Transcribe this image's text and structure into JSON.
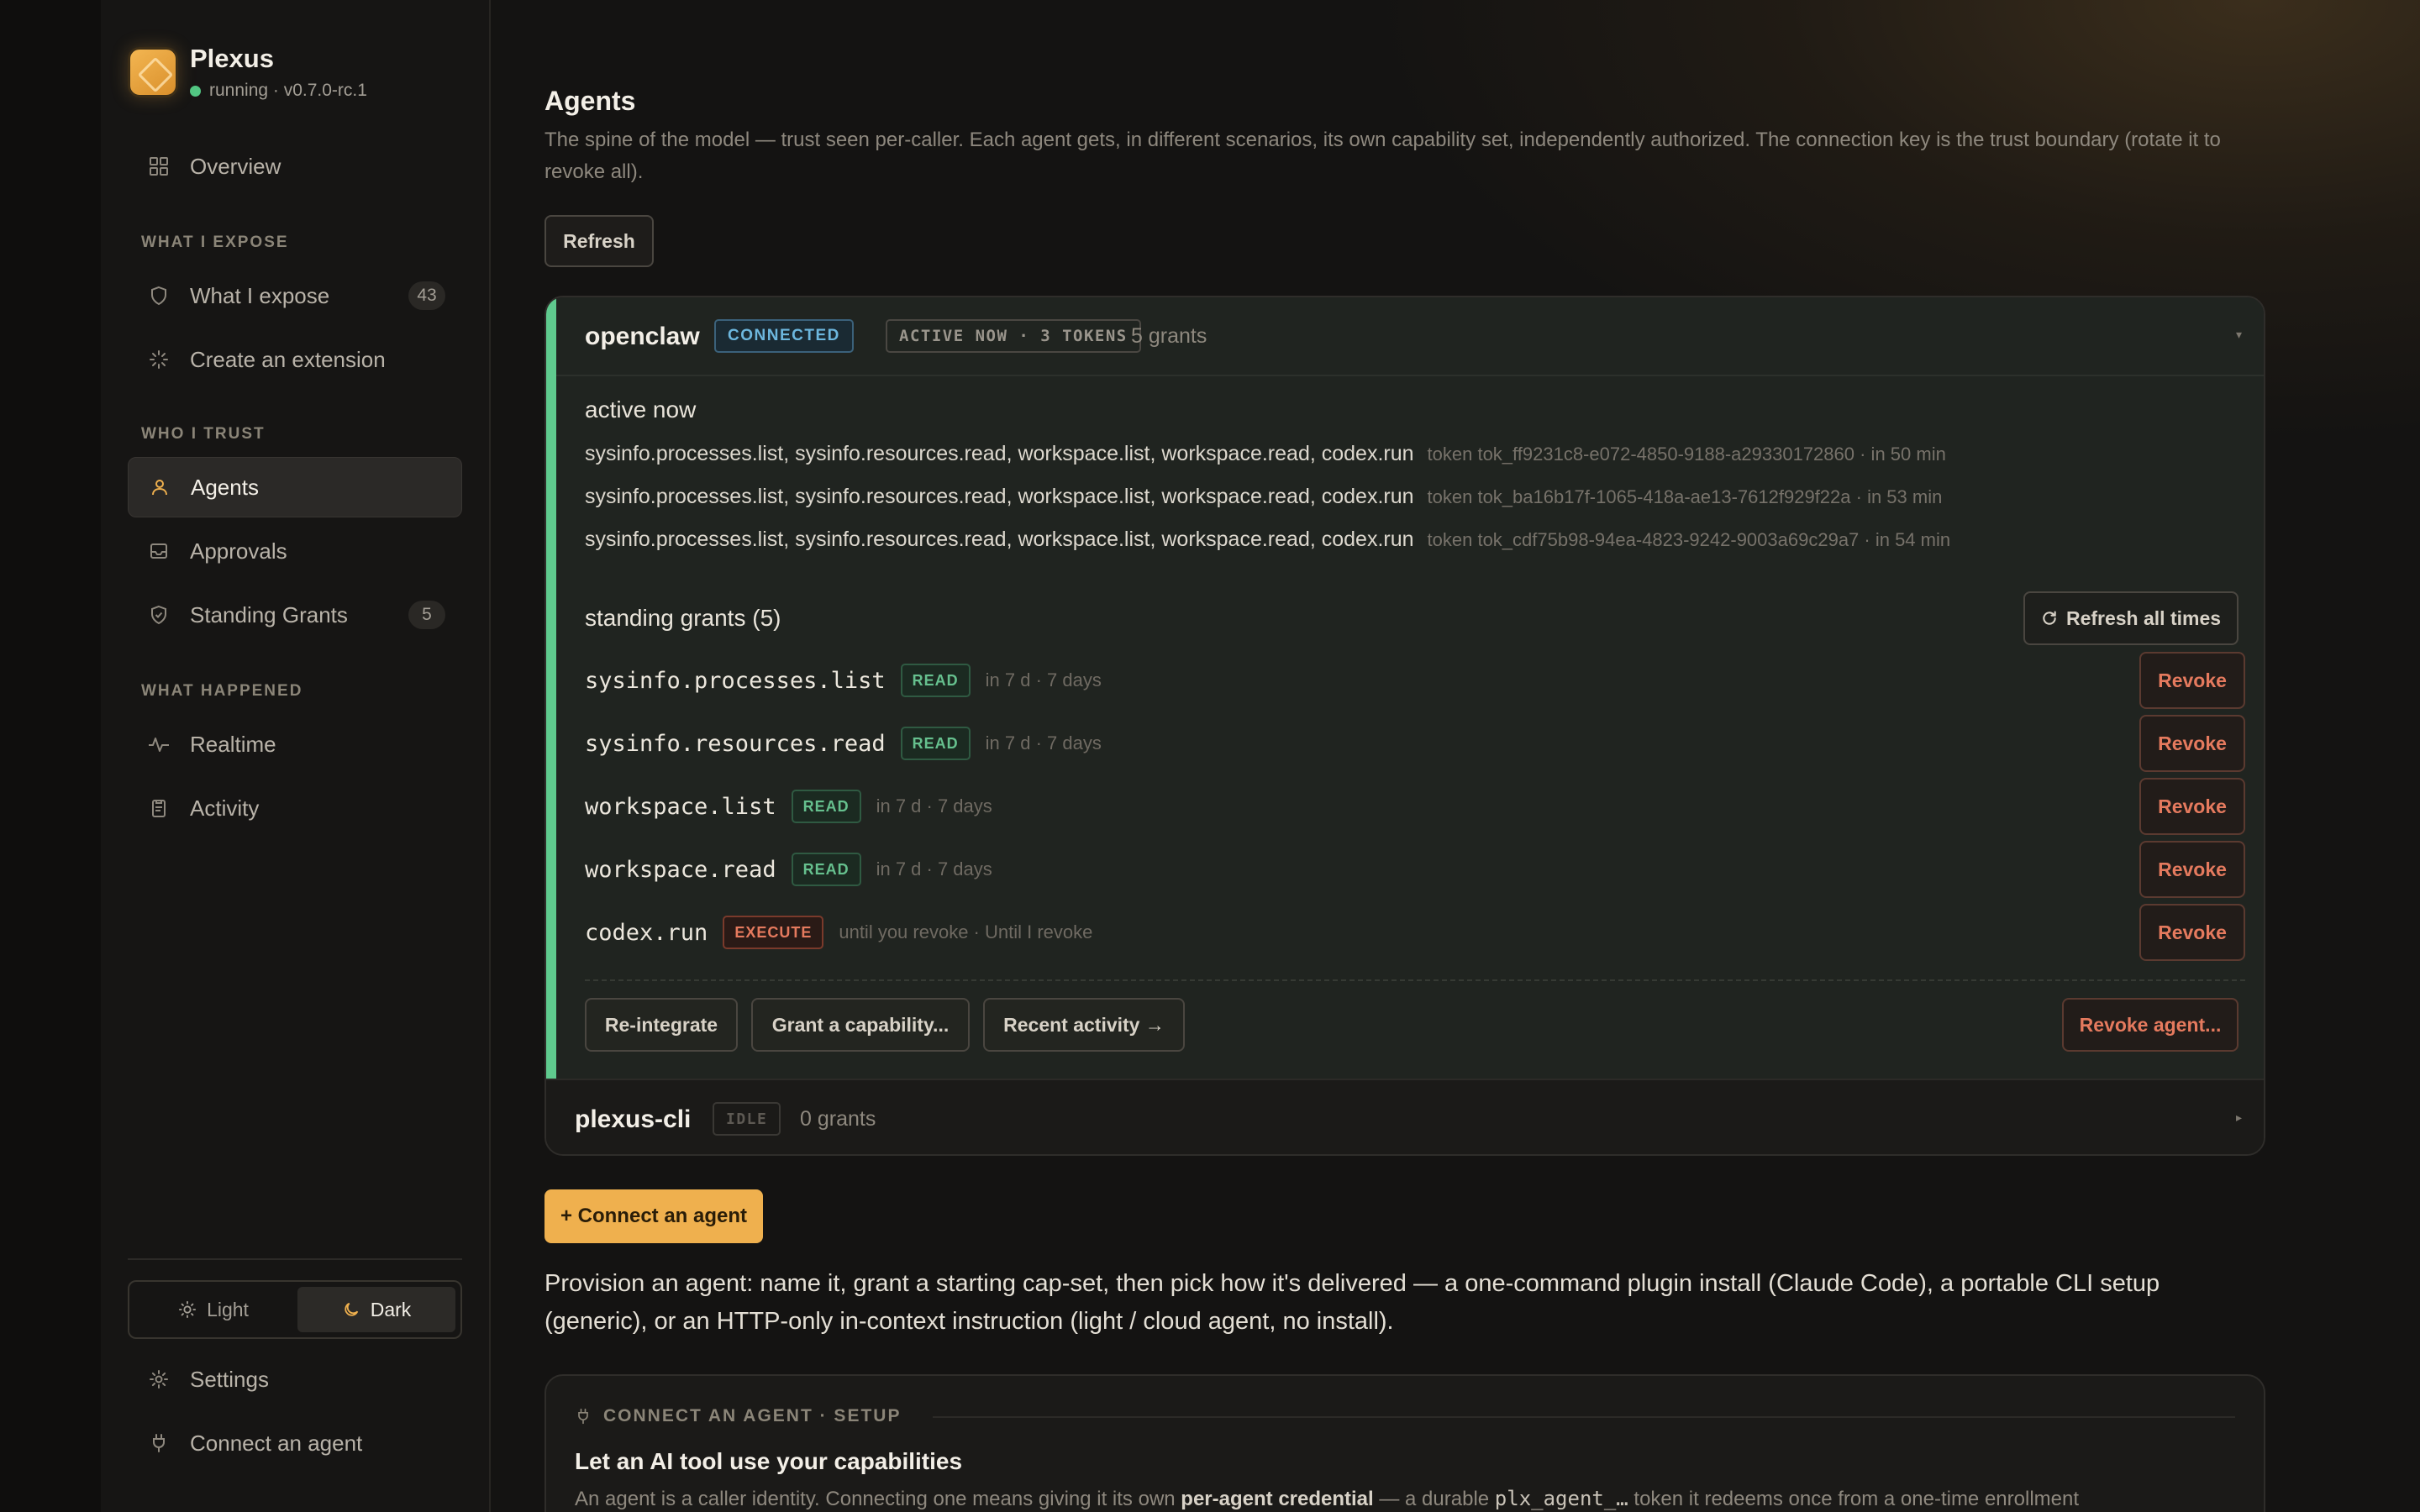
{
  "brand": {
    "name": "Plexus",
    "status": "running · v0.7.0-rc.1"
  },
  "nav": {
    "overview": "Overview",
    "section_expose": "WHAT I EXPOSE",
    "what_i_expose": "What I expose",
    "what_i_expose_count": "43",
    "create_extension": "Create an extension",
    "section_trust": "WHO I TRUST",
    "agents": "Agents",
    "approvals": "Approvals",
    "standing_grants": "Standing Grants",
    "standing_grants_count": "5",
    "section_happened": "WHAT HAPPENED",
    "realtime": "Realtime",
    "activity": "Activity",
    "theme_light": "Light",
    "theme_dark": "Dark",
    "settings": "Settings",
    "connect_agent": "Connect an agent"
  },
  "page": {
    "title": "Agents",
    "description": "The spine of the model — trust seen per-caller. Each agent gets, in different scenarios, its own capability set, independently authorized. The connection key is the trust boundary (rotate it to revoke all).",
    "refresh": "Refresh"
  },
  "agents": [
    {
      "name": "openclaw",
      "status_badge": "CONNECTED",
      "activity_badge": "ACTIVE NOW · 3 TOKENS",
      "grants_label": "5 grants",
      "active_title": "active now",
      "tokens": [
        {
          "caps": "sysinfo.processes.list, sysinfo.resources.read, workspace.list, workspace.read, codex.run",
          "meta": "token tok_ff9231c8-e072-4850-9188-a29330172860 · in 50 min"
        },
        {
          "caps": "sysinfo.processes.list, sysinfo.resources.read, workspace.list, workspace.read, codex.run",
          "meta": "token tok_ba16b17f-1065-418a-ae13-7612f929f22a · in 53 min"
        },
        {
          "caps": "sysinfo.processes.list, sysinfo.resources.read, workspace.list, workspace.read, codex.run",
          "meta": "token tok_cdf75b98-94ea-4823-9242-9003a69c29a7 · in 54 min"
        }
      ],
      "standing_title": "standing grants (5)",
      "refresh_all": "Refresh all times",
      "grants": [
        {
          "cap": "sysinfo.processes.list",
          "mode": "READ",
          "when": "in 7 d · 7 days",
          "revoke": "Revoke"
        },
        {
          "cap": "sysinfo.resources.read",
          "mode": "READ",
          "when": "in 7 d · 7 days",
          "revoke": "Revoke"
        },
        {
          "cap": "workspace.list",
          "mode": "READ",
          "when": "in 7 d · 7 days",
          "revoke": "Revoke"
        },
        {
          "cap": "workspace.read",
          "mode": "READ",
          "when": "in 7 d · 7 days",
          "revoke": "Revoke"
        },
        {
          "cap": "codex.run",
          "mode": "EXECUTE",
          "when": "until you revoke · Until I revoke",
          "revoke": "Revoke"
        }
      ],
      "actions": {
        "reintegrate": "Re-integrate",
        "grant": "Grant a capability...",
        "recent": "Recent activity →",
        "revoke_agent": "Revoke agent..."
      }
    },
    {
      "name": "plexus-cli",
      "status_badge": "IDLE",
      "grants_label": "0 grants"
    }
  ],
  "connect": {
    "button": "+ Connect an agent",
    "provision_text": "Provision an agent: name it, grant a starting cap-set, then pick how it's delivered — a one-command plugin install (Claude Code), a portable CLI setup (generic), or an HTTP-only in-context instruction (light / cloud agent, no install)."
  },
  "setup": {
    "kicker": "CONNECT AN AGENT · SETUP",
    "title": "Let an AI tool use your capabilities",
    "desc_1": "An agent is a caller identity. Connecting one means giving it its own ",
    "desc_bold": "per-agent credential",
    "desc_2": " — a durable ",
    "desc_code": "plx_agent_…",
    "desc_3": " token it redeems once from a one-time enrollment"
  },
  "colors": {
    "accent": "#efb04e",
    "connected": "#6db7de",
    "active_bar": "#5fca8e",
    "read": "#66c08e",
    "execute": "#e57a5e",
    "revoke": "#e57a5e"
  }
}
